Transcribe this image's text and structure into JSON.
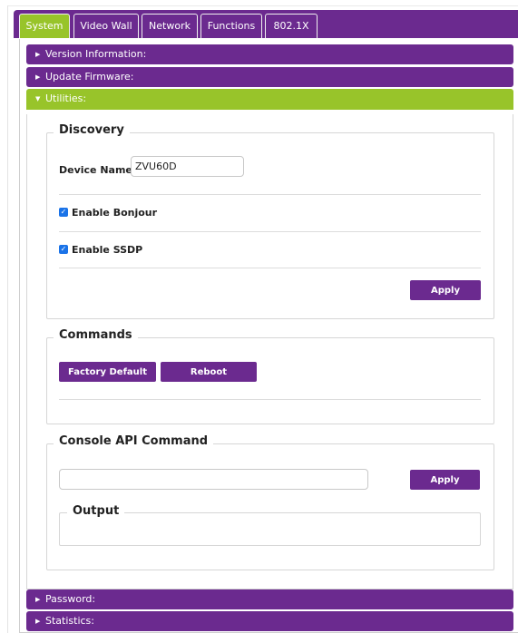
{
  "tabs": [
    "System",
    "Video Wall",
    "Network",
    "Functions",
    "802.1X"
  ],
  "active_tab": "System",
  "sections": {
    "version": "Version Information:",
    "firmware": "Update Firmware:",
    "utilities": "Utilities:",
    "password": "Password:",
    "statistics": "Statistics:"
  },
  "discovery": {
    "title": "Discovery",
    "device_name_label": "Device Name:",
    "device_name_value": "ZVU60D",
    "bonjour_label": "Enable Bonjour",
    "bonjour_checked": true,
    "ssdp_label": "Enable SSDP",
    "ssdp_checked": true,
    "apply_label": "Apply"
  },
  "commands": {
    "title": "Commands",
    "factory_default_label": "Factory Default",
    "reboot_label": "Reboot"
  },
  "console": {
    "title": "Console API Command",
    "command_value": "",
    "apply_label": "Apply",
    "output_title": "Output"
  },
  "colors": {
    "purple": "#6b2a8f",
    "green": "#98c42a",
    "checkbox_blue": "#1a73e8"
  }
}
